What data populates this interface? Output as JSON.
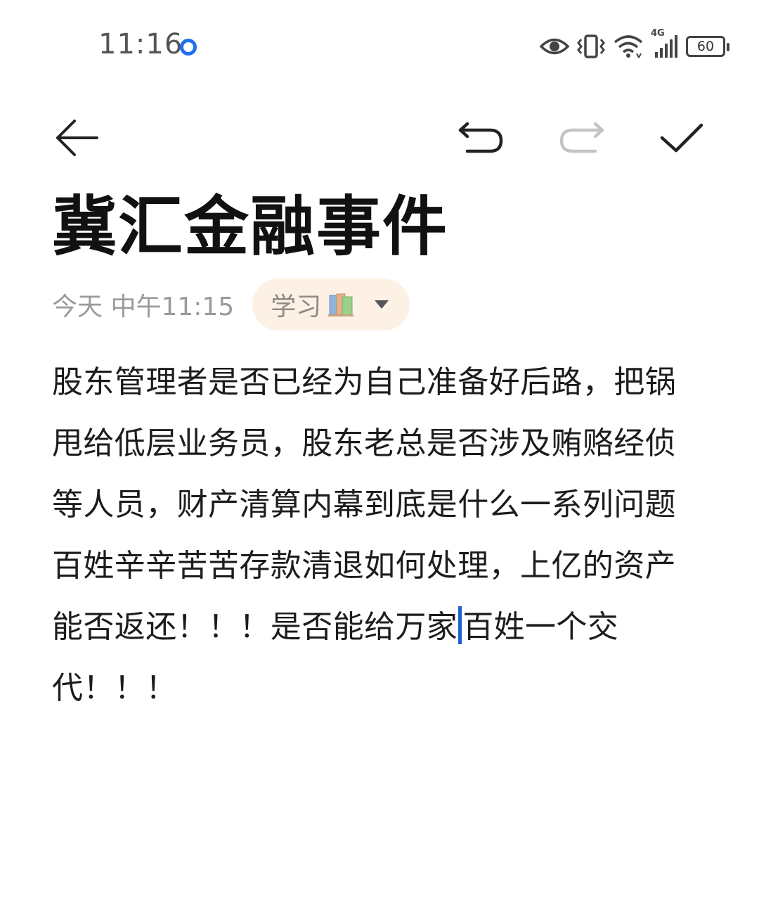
{
  "status_bar": {
    "time": "11:16",
    "network_label": "4G",
    "battery": "60"
  },
  "toolbar": {
    "icons": [
      "back-arrow-icon",
      "undo-icon",
      "redo-icon",
      "check-icon"
    ]
  },
  "note": {
    "title": "冀汇金融事件",
    "meta_time": "今天 中午11:15",
    "category": "学习",
    "body": {
      "paragraph_1": "股东管理者是否已经为自己准备好后路，把锅甩给低层业务员，股东老总是否涉及贿赂经侦等人员，财产清算内幕到底是什么一系列问题",
      "paragraph_2_before_caret": "百姓辛辛苦苦存款清退如何处理，上亿的资产能否返还！！！是否能给万家",
      "paragraph_2_after_caret": "百姓一个交代！！！"
    }
  },
  "colors": {
    "accent": "#1f6ff0",
    "chip_background": "#fdf1e6",
    "meta_text": "#9a9a9a"
  }
}
